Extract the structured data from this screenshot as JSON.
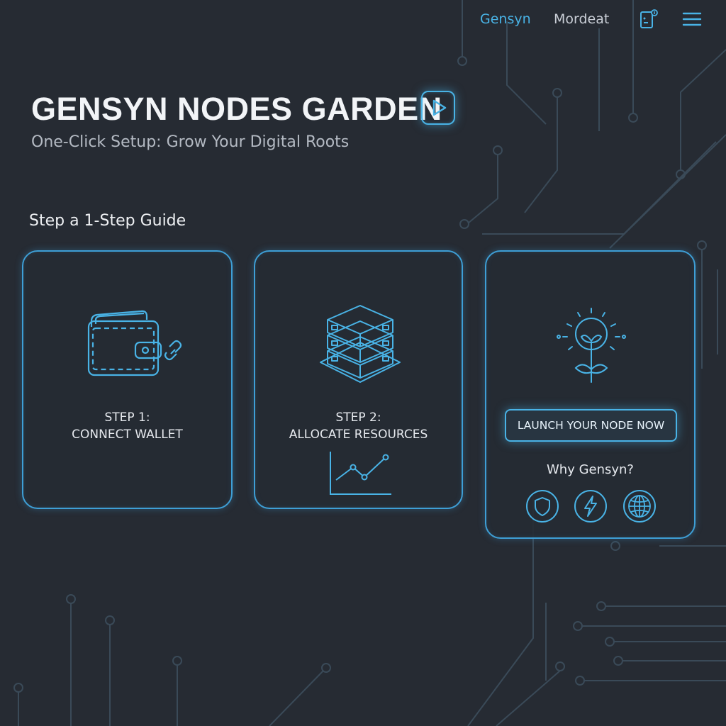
{
  "nav": {
    "links": [
      "Gensyn",
      "Mordeat"
    ],
    "icons": [
      "device-icon",
      "menu-icon"
    ]
  },
  "hero": {
    "title": "GENSYN NODES GARDEN",
    "subtitle": "One-Click Setup: Grow Your Digital Roots",
    "play_icon": "play-icon"
  },
  "guide": {
    "heading": "Step a 1-Step Guide",
    "steps": [
      {
        "line1": "STEP 1:",
        "line2": "CONNECT WALLET",
        "icon": "wallet-icon"
      },
      {
        "line1": "STEP 2:",
        "line2": "ALLOCATE RESOURCES",
        "icon": "server-stack-icon"
      }
    ],
    "launch": {
      "button_label": "LAUNCH YOUR NODE NOW",
      "icon": "sprout-bulb-icon",
      "why_label": "Why Gensyn?",
      "feature_icons": [
        "shield-icon",
        "lightning-icon",
        "globe-icon"
      ]
    }
  },
  "colors": {
    "background": "#262b33",
    "accent": "#49b3e6",
    "card_border": "#3e9fd6",
    "circuit": "#3a4a58"
  }
}
